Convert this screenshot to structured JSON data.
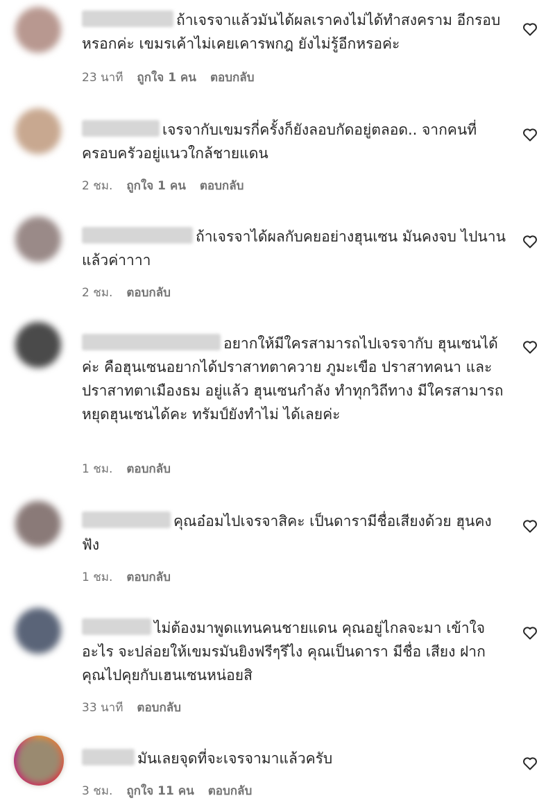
{
  "comments": [
    {
      "body": "ถ้าเจรจาแล้วมันได้ผลเราคงไม่ได้ทำสงคราม อีกรอบหรอกค่ะ เขมรเค้าไม่เคยเคารพกฎ ยังไม่รู้อีกหรอค่ะ",
      "time": "23 นาที",
      "likes": "ถูกใจ 1 คน",
      "reply": "ตอบกลับ",
      "avatar_color": "#b89890"
    },
    {
      "body": "เจรจากับเขมรกี่ครั้งก็ยังลอบกัดอยู่ตลอด.. จากคนที่ครอบครัวอยู่แนวใกล้ชายแดน",
      "time": "2 ชม.",
      "likes": "ถูกใจ 1 คน",
      "reply": "ตอบกลับ",
      "avatar_color": "#c8a890"
    },
    {
      "body": "ถ้าเจรจาได้ผลกับคยอย่างฮุนเซน มันคงจบ ไปนานแล้วค่าาาา",
      "time": "2 ชม.",
      "likes": "",
      "reply": "ตอบกลับ",
      "avatar_color": "#9a8a88"
    },
    {
      "body": "อยากให้มีใครสามารถไปเจรจากับ ฮุนเซนได้ค่ะ คือฮุนเซนอยากได้ปราสาทตาควาย ภูมะเขือ ปราสาทคนา และปราสาทตาเมืองธม อยู่แล้ว ฮุนเซนกำลัง ทำทุกวิถีทาง มีใครสามารถหยุดฮุนเซนได้คะ ทรัมป์ยังทำไม่ ได้เลยค่ะ",
      "time": "1 ชม.",
      "likes": "",
      "reply": "ตอบกลับ",
      "avatar_color": "#4a4a4a"
    },
    {
      "body": "คุณอ๋อมไปเจรจาสิคะ เป็นดารามีชื่อเสียงด้วย ฮุนคงฟัง",
      "time": "1 ชม.",
      "likes": "",
      "reply": "ตอบกลับ",
      "avatar_color": "#8a7a78"
    },
    {
      "body": "ไม่ต้องมาพูดแทนคนชายแดน คุณอยู่ไกลจะมา เข้าใจอะไร จะปล่อยให้เขมรมันยิงฟรีๆรึไง คุณเป็นดารา มีชื่อ เสียง ฝากคุณไปคุยกับเฮนเซนหน่อยสิ",
      "time": "33 นาที",
      "likes": "",
      "reply": "ตอบกลับ",
      "avatar_color": "#5a6478"
    },
    {
      "body": "มันเลยจุดที่จะเจรจามาแล้วครับ",
      "time": "3 ชม.",
      "likes": "ถูกใจ 11 คน",
      "reply": "ตอบกลับ",
      "avatar_color": "#9a8a70"
    }
  ],
  "colors": {
    "text": "#262626",
    "meta": "#737373",
    "background": "#ffffff"
  },
  "icons": {
    "like": "heart-outline-icon"
  }
}
